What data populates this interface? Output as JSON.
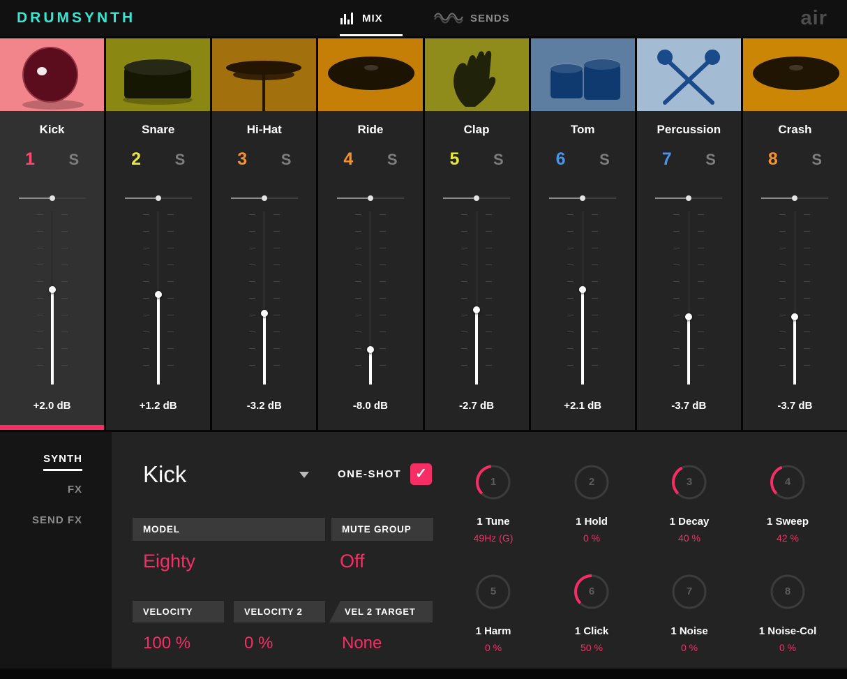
{
  "accent": "#f72e66",
  "header": {
    "logo": "DRUMSYNTH",
    "mix_tab": "MIX",
    "sends_tab": "SENDS",
    "brand": "air"
  },
  "channels": [
    {
      "name": "Kick",
      "number": "1",
      "number_color": "#fa4a71",
      "solo": "S",
      "db": "+2.0 dB",
      "fader_pos": 0.45,
      "selected": true,
      "thumb": {
        "kind": "kick",
        "bg": "#f2848c",
        "fg": "#5c0d1d"
      }
    },
    {
      "name": "Snare",
      "number": "2",
      "number_color": "#e8e838",
      "solo": "S",
      "db": "+1.2 dB",
      "fader_pos": 0.48,
      "selected": false,
      "thumb": {
        "kind": "snare",
        "bg": "#8a8712",
        "fg": "#151703"
      }
    },
    {
      "name": "Hi-Hat",
      "number": "3",
      "number_color": "#f5922e",
      "solo": "S",
      "db": "-3.2 dB",
      "fader_pos": 0.59,
      "selected": false,
      "thumb": {
        "kind": "hihat",
        "bg": "#a2700c",
        "fg": "#241503"
      }
    },
    {
      "name": "Ride",
      "number": "4",
      "number_color": "#f5922e",
      "solo": "S",
      "db": "-8.0 dB",
      "fader_pos": 0.8,
      "selected": false,
      "thumb": {
        "kind": "cymbal",
        "bg": "#c57f06",
        "fg": "#1c1303"
      }
    },
    {
      "name": "Clap",
      "number": "5",
      "number_color": "#e8e838",
      "solo": "S",
      "db": "-2.7 dB",
      "fader_pos": 0.57,
      "selected": false,
      "thumb": {
        "kind": "clap",
        "bg": "#8f8c1c",
        "fg": "#20220a"
      }
    },
    {
      "name": "Tom",
      "number": "6",
      "number_color": "#4b93e8",
      "solo": "S",
      "db": "+2.1 dB",
      "fader_pos": 0.45,
      "selected": false,
      "thumb": {
        "kind": "tom",
        "bg": "#5d7da1",
        "fg": "#0e3a70"
      }
    },
    {
      "name": "Percussion",
      "number": "7",
      "number_color": "#4b93e8",
      "solo": "S",
      "db": "-3.7 dB",
      "fader_pos": 0.61,
      "selected": false,
      "thumb": {
        "kind": "mallets",
        "bg": "#a3bcd4",
        "fg": "#1b4a8a"
      }
    },
    {
      "name": "Crash",
      "number": "8",
      "number_color": "#f5922e",
      "solo": "S",
      "db": "-3.7 dB",
      "fader_pos": 0.61,
      "selected": false,
      "thumb": {
        "kind": "cymbal",
        "bg": "#cc8606",
        "fg": "#201503"
      }
    }
  ],
  "sidebar": [
    {
      "label": "SYNTH",
      "active": true
    },
    {
      "label": "FX",
      "active": false
    },
    {
      "label": "SEND FX",
      "active": false
    }
  ],
  "editor": {
    "title": "Kick",
    "one_shot": {
      "label": "ONE-SHOT",
      "checked": true,
      "check_glyph": "✓"
    },
    "model": {
      "label": "MODEL",
      "value": "Eighty"
    },
    "mute_group": {
      "label": "MUTE GROUP",
      "value": "Off"
    },
    "velocity": {
      "label": "VELOCITY",
      "value": "100 %"
    },
    "velocity2": {
      "label": "VELOCITY 2",
      "value": "0 %"
    },
    "vel2_target": {
      "label": "VEL 2 TARGET",
      "value": "None"
    },
    "knobs": [
      {
        "index": "1",
        "label": "1 Tune",
        "value": "49Hz (G)",
        "pct": 0.47
      },
      {
        "index": "2",
        "label": "1 Hold",
        "value": "0 %",
        "pct": 0
      },
      {
        "index": "3",
        "label": "1 Decay",
        "value": "40 %",
        "pct": 0.4
      },
      {
        "index": "4",
        "label": "1 Sweep",
        "value": "42 %",
        "pct": 0.42
      },
      {
        "index": "5",
        "label": "1 Harm",
        "value": "0 %",
        "pct": 0
      },
      {
        "index": "6",
        "label": "1 Click",
        "value": "50 %",
        "pct": 0.5
      },
      {
        "index": "7",
        "label": "1 Noise",
        "value": "0 %",
        "pct": 0
      },
      {
        "index": "8",
        "label": "1 Noise-Col",
        "value": "0 %",
        "pct": 0
      }
    ]
  }
}
